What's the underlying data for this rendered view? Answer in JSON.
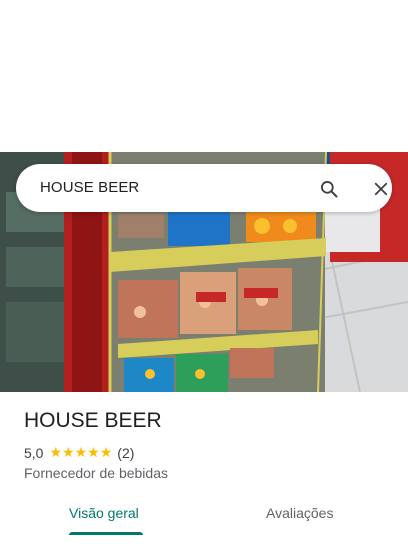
{
  "search": {
    "query": "HOUSE BEER",
    "search_icon": "search-icon",
    "close_icon": "close-icon"
  },
  "place": {
    "name": "HOUSE BEER",
    "rating": "5,0",
    "stars": 5,
    "review_count": "(2)",
    "category": "Fornecedor de bebidas"
  },
  "tabs": [
    {
      "label": "Visão geral",
      "active": true
    },
    {
      "label": "Avaliações",
      "active": false
    }
  ],
  "colors": {
    "accent": "#00796b",
    "star": "#fbbc04"
  }
}
